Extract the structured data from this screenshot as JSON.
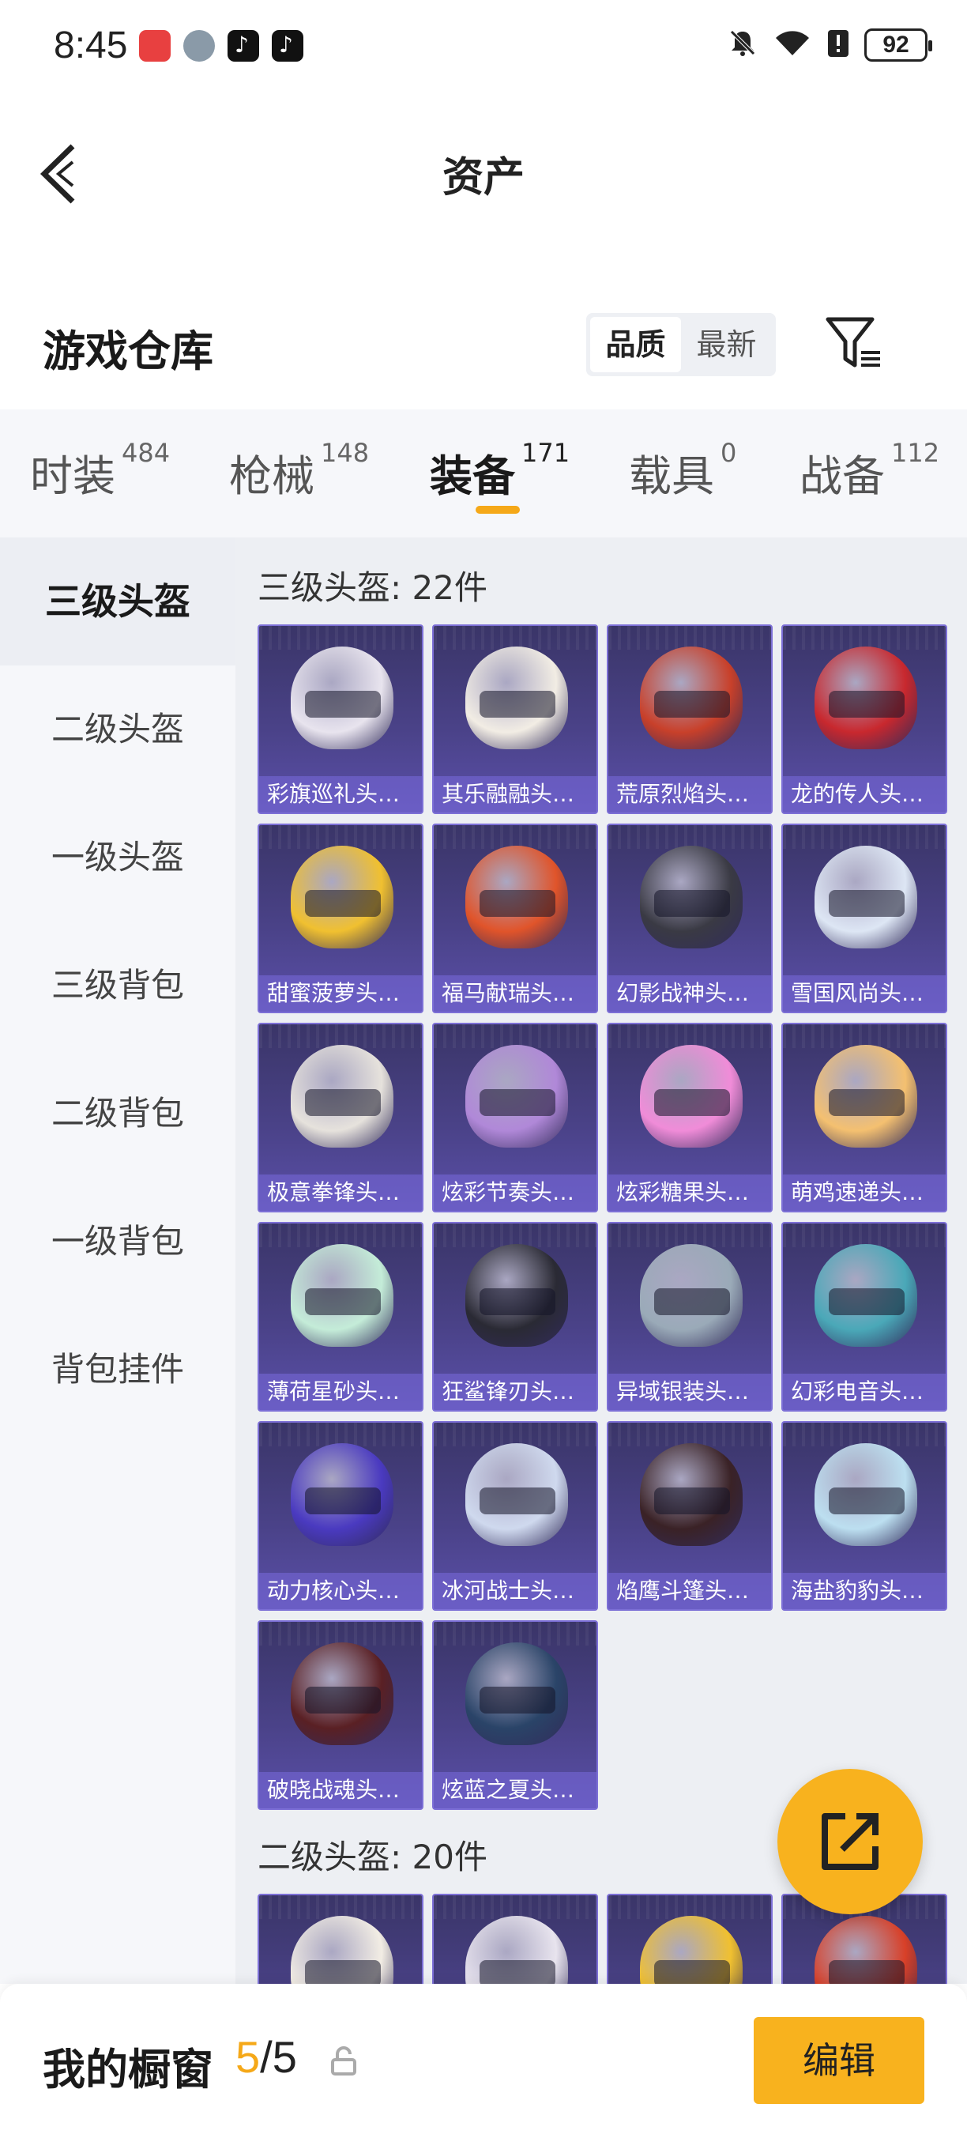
{
  "status_bar": {
    "time": "8:45",
    "battery": "92",
    "app_icons": [
      "huawei-app-icon",
      "avatar-app-icon",
      "tiktok-icon",
      "tiktok-icon"
    ],
    "right_icons": [
      "mute-bell-icon",
      "wifi-icon",
      "alert-icon",
      "battery-icon"
    ]
  },
  "nav": {
    "title": "资产"
  },
  "warehouse": {
    "title": "游戏仓库",
    "sort_options": [
      "品质",
      "最新"
    ],
    "sort_active": "品质"
  },
  "tabs": [
    {
      "label": "时装",
      "count": "484"
    },
    {
      "label": "枪械",
      "count": "148"
    },
    {
      "label": "装备",
      "count": "171"
    },
    {
      "label": "载具",
      "count": "0"
    },
    {
      "label": "战备",
      "count": "112"
    }
  ],
  "sidebar": {
    "items": [
      {
        "label": "三级头盔"
      },
      {
        "label": "二级头盔"
      },
      {
        "label": "一级头盔"
      },
      {
        "label": "三级背包"
      },
      {
        "label": "二级背包"
      },
      {
        "label": "一级背包"
      },
      {
        "label": "背包挂件"
      }
    ]
  },
  "sections": [
    {
      "title": "三级头盔: 22件",
      "items": [
        {
          "label": "彩旗巡礼头…",
          "color": "#e8e4ee"
        },
        {
          "label": "其乐融融头…",
          "color": "#f2ede4"
        },
        {
          "label": "荒原烈焰头…",
          "color": "#c8402a"
        },
        {
          "label": "龙的传人头…",
          "color": "#c8282e"
        },
        {
          "label": "甜蜜菠萝头…",
          "color": "#f0c030"
        },
        {
          "label": "福马献瑞头…",
          "color": "#e0542a"
        },
        {
          "label": "幻影战神头…",
          "color": "#3a3a44"
        },
        {
          "label": "雪国风尚头…",
          "color": "#dde6f4"
        },
        {
          "label": "极意拳锋头…",
          "color": "#e6e2dc"
        },
        {
          "label": "炫彩节奏头…",
          "color": "#b088d8"
        },
        {
          "label": "炫彩糖果头…",
          "color": "#f08cd8"
        },
        {
          "label": "萌鸡速递头…",
          "color": "#f4c070"
        },
        {
          "label": "薄荷星砂头…",
          "color": "#c4ecd8"
        },
        {
          "label": "狂鲨锋刃头…",
          "color": "#2a2a34"
        },
        {
          "label": "异域银装头…",
          "color": "#9aaab8"
        },
        {
          "label": "幻彩电音头…",
          "color": "#4aa8b8"
        },
        {
          "label": "动力核心头…",
          "color": "#4a3ac0"
        },
        {
          "label": "冰河战士头…",
          "color": "#cfd9ee"
        },
        {
          "label": "焰鹰斗篷头…",
          "color": "#3a2226"
        },
        {
          "label": "海盐豹豹头…",
          "color": "#bcdff0"
        },
        {
          "label": "破晓战魂头…",
          "color": "#5a2024"
        },
        {
          "label": "炫蓝之夏头…",
          "color": "#2a4468"
        }
      ]
    },
    {
      "title": "二级头盔: 20件",
      "items": [
        {
          "label": "",
          "color": "#f2ede4"
        },
        {
          "label": "",
          "color": "#e8e4ee"
        },
        {
          "label": "",
          "color": "#f0c030"
        },
        {
          "label": "",
          "color": "#d84028"
        }
      ]
    }
  ],
  "bottom_bar": {
    "title": "我的橱窗",
    "count_current": "5",
    "count_sep": "/",
    "count_total": "5",
    "edit_label": "编辑"
  },
  "colors": {
    "accent": "#f8b21e",
    "card_bg": "#4a4288",
    "card_border": "#7c6fd6"
  }
}
